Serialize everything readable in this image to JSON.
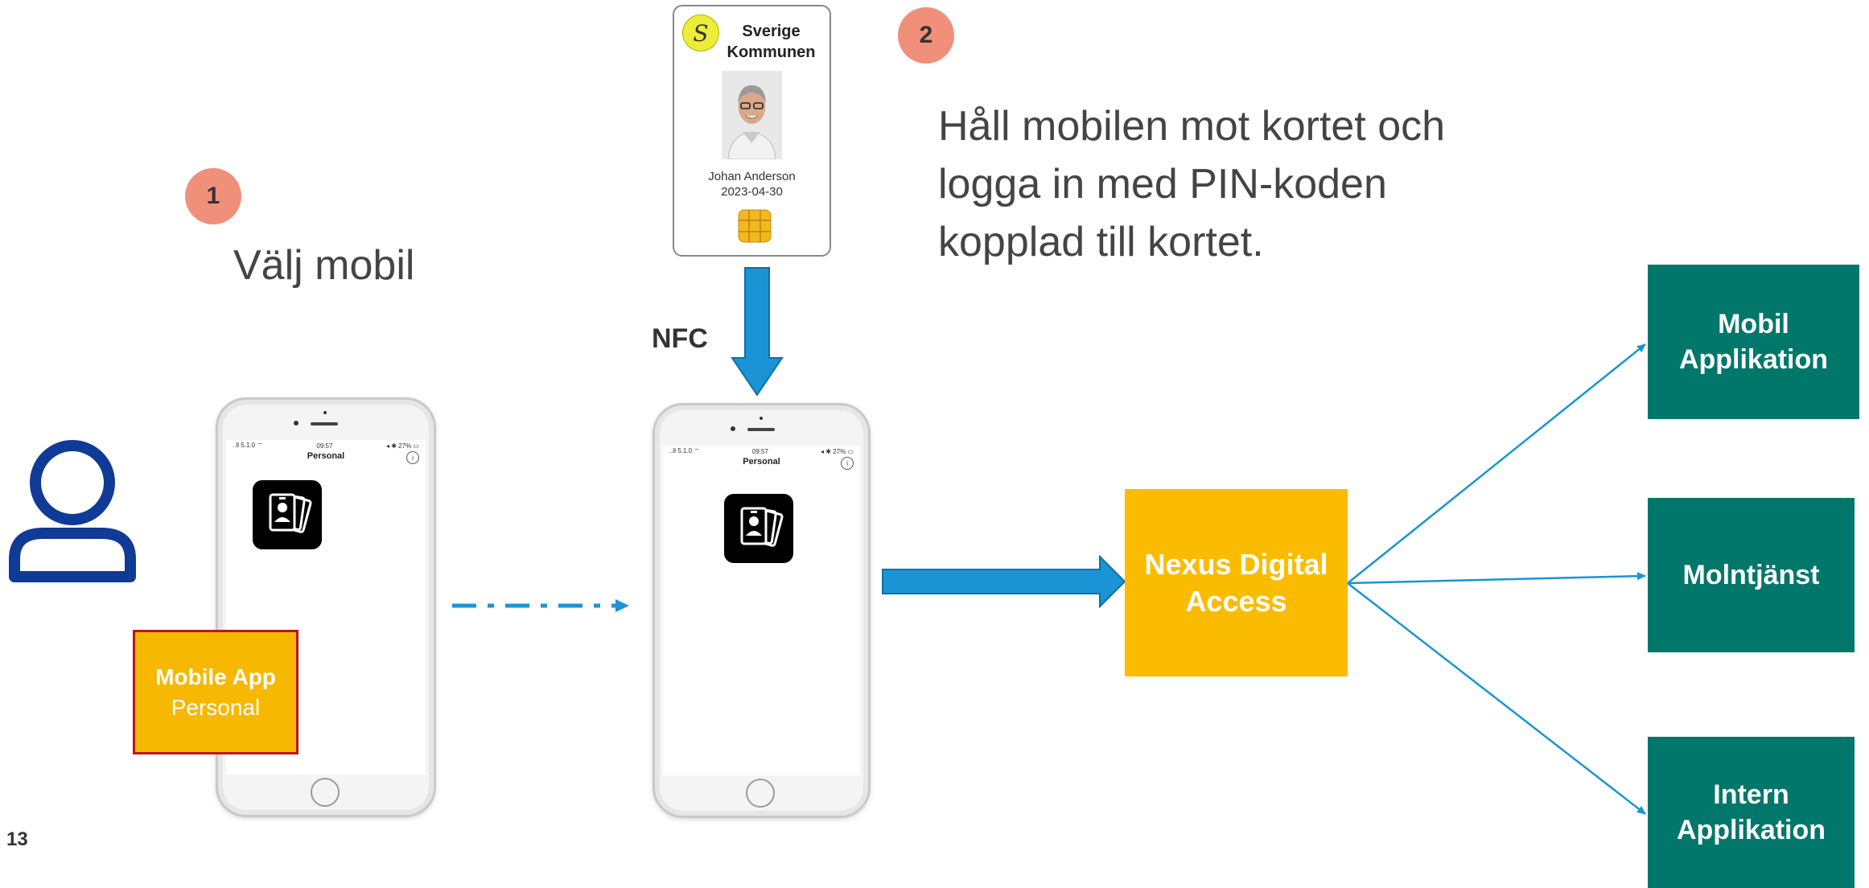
{
  "page_number": "13",
  "steps": [
    {
      "number": "1",
      "text": "Välj mobil"
    },
    {
      "number": "2",
      "lines": [
        "Håll mobilen mot kortet och",
        "logga in med PIN-koden",
        "kopplad till kortet."
      ]
    }
  ],
  "id_card": {
    "org_line1": "Sverige",
    "org_line2": "Kommunen",
    "logo_glyph": "S",
    "holder_name": "Johan Anderson",
    "expiry": "2023-04-30"
  },
  "nfc_label": "NFC",
  "phone_screen": {
    "status_left": "..ll 5.1.0 ⌔",
    "status_time": "09:57",
    "status_right": "◂ ✱ 27% ▭",
    "title": "Personal",
    "info_glyph": "i"
  },
  "mobile_app_box": {
    "line1": "Mobile App",
    "line2": "Personal"
  },
  "nexus_box": {
    "line1": "Nexus Digital",
    "line2": "Access"
  },
  "targets": [
    {
      "line1": "Mobil",
      "line2": "Applikation"
    },
    {
      "line1": "Molntjänst"
    },
    {
      "line1": "Intern",
      "line2": "Applikation"
    }
  ],
  "colors": {
    "step_badge": "#f0907a",
    "arrow_blue": "#1a94d4",
    "nexus_yellow": "#fbbc00",
    "target_green": "#00776a",
    "user_icon_blue": "#0f3a96",
    "mobile_app_border": "#c0141c"
  },
  "icons": [
    "user-icon",
    "id-badge-icon",
    "chip-icon",
    "person-photo"
  ]
}
